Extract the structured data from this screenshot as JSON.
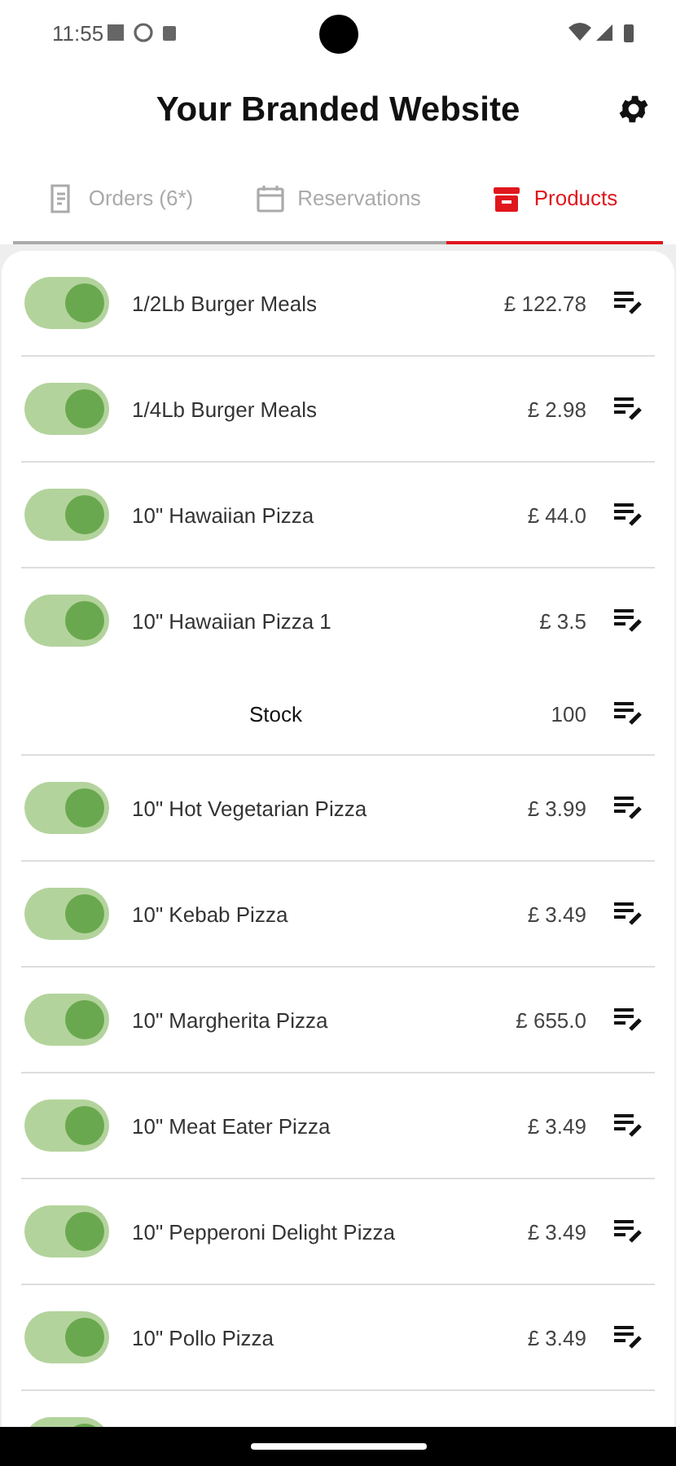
{
  "status_bar": {
    "time": "11:55"
  },
  "app_bar": {
    "title": "Your Branded Website"
  },
  "tabs": [
    {
      "label": "Orders (6*)",
      "kind": "receipt",
      "selected": false
    },
    {
      "label": "Reservations",
      "kind": "calendar",
      "selected": false
    },
    {
      "label": "Products",
      "kind": "store",
      "selected": true
    }
  ],
  "products": [
    {
      "name": "1/2Lb Burger Meals",
      "price": "£ 122.78",
      "on": true
    },
    {
      "name": "1/4Lb Burger Meals",
      "price": "£ 2.98",
      "on": true
    },
    {
      "name": "10\" Hawaiian Pizza",
      "price": "£ 44.0",
      "on": true
    },
    {
      "name": "10\" Hawaiian Pizza 1",
      "price": "£ 3.5",
      "on": true,
      "stock": {
        "label": "Stock",
        "value": "100"
      }
    },
    {
      "name": "10\" Hot Vegetarian Pizza",
      "price": "£ 3.99",
      "on": true
    },
    {
      "name": "10\" Kebab Pizza",
      "price": "£ 3.49",
      "on": true
    },
    {
      "name": "10\" Margherita Pizza",
      "price": "£ 655.0",
      "on": true
    },
    {
      "name": "10\" Meat Eater Pizza",
      "price": "£ 3.49",
      "on": true
    },
    {
      "name": "10\" Pepperoni Delight Pizza",
      "price": "£ 3.49",
      "on": true
    },
    {
      "name": "10\" Pollo Pizza",
      "price": "£ 3.49",
      "on": true
    },
    {
      "on": true
    }
  ]
}
